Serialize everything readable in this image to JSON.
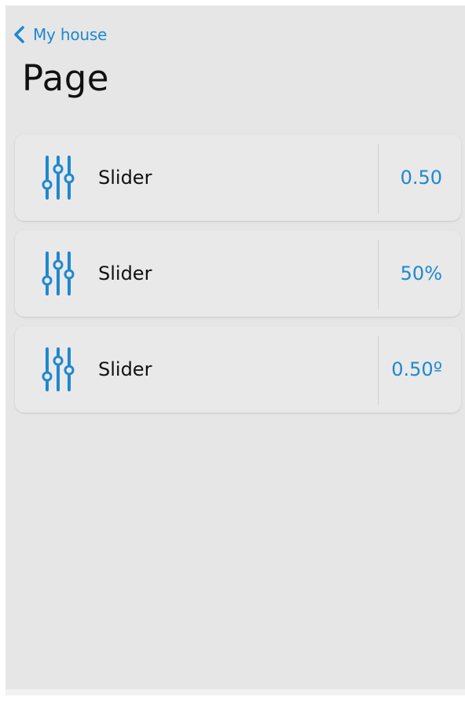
{
  "header": {
    "back_label": "My house",
    "title": "Page"
  },
  "colors": {
    "accent": "#1e88d0",
    "background": "#e6e6e6",
    "card": "#e9e9e9"
  },
  "rows": [
    {
      "icon": "sliders-icon",
      "label": "Slider",
      "value": "0.50"
    },
    {
      "icon": "sliders-icon",
      "label": "Slider",
      "value": "50%"
    },
    {
      "icon": "sliders-icon",
      "label": "Slider",
      "value": "0.50º"
    }
  ]
}
